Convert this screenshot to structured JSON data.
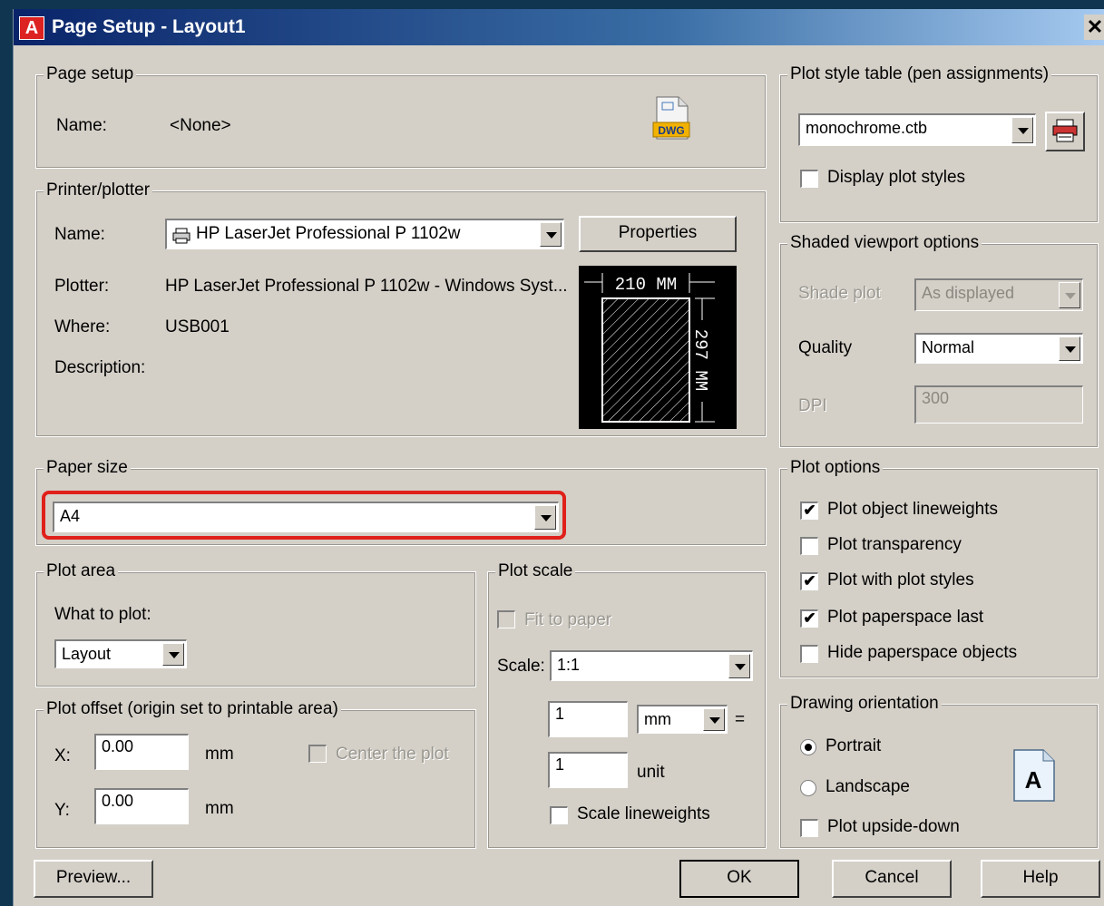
{
  "window": {
    "title": "Page Setup - Layout1",
    "close_glyph": "✕",
    "app_icon_letter": "A"
  },
  "page_setup": {
    "group_label": "Page setup",
    "name_label": "Name:",
    "name_value": "<None>",
    "dwg_icon_label": "DWG"
  },
  "printer": {
    "group_label": "Printer/plotter",
    "name_label": "Name:",
    "name_value": "HP LaserJet Professional P 1102w",
    "properties_label": "Properties",
    "plotter_label": "Plotter:",
    "plotter_value": "HP LaserJet Professional P 1102w - Windows Syst...",
    "where_label": "Where:",
    "where_value": "USB001",
    "description_label": "Description:",
    "preview_width_label": "210 MM",
    "preview_height_label": "297 MM"
  },
  "paper_size": {
    "group_label": "Paper size",
    "value": "A4",
    "highlight_color": "#e0201a"
  },
  "plot_area": {
    "group_label": "Plot area",
    "what_label": "What to plot:",
    "what_value": "Layout"
  },
  "plot_offset": {
    "group_label": "Plot offset (origin set to printable area)",
    "x_label": "X:",
    "x_value": "0.00",
    "x_unit": "mm",
    "y_label": "Y:",
    "y_value": "0.00",
    "y_unit": "mm",
    "center_label": "Center the plot"
  },
  "plot_scale": {
    "group_label": "Plot scale",
    "fit_label": "Fit to paper",
    "scale_label": "Scale:",
    "scale_value": "1:1",
    "num1_value": "1",
    "unit_select_value": "mm",
    "equals": "=",
    "num2_value": "1",
    "unit2_label": "unit",
    "lineweights_label": "Scale lineweights"
  },
  "plot_style": {
    "group_label": "Plot style table (pen assignments)",
    "value": "monochrome.ctb",
    "display_label": "Display plot styles"
  },
  "shaded": {
    "group_label": "Shaded viewport options",
    "shade_label": "Shade plot",
    "shade_value": "As displayed",
    "quality_label": "Quality",
    "quality_value": "Normal",
    "dpi_label": "DPI",
    "dpi_value": "300"
  },
  "plot_options": {
    "group_label": "Plot options",
    "items": [
      {
        "label": "Plot object lineweights",
        "checked": true
      },
      {
        "label": "Plot transparency",
        "checked": false
      },
      {
        "label": "Plot with plot styles",
        "checked": true
      },
      {
        "label": "Plot paperspace last",
        "checked": true
      },
      {
        "label": "Hide paperspace objects",
        "checked": false
      }
    ]
  },
  "orientation": {
    "group_label": "Drawing orientation",
    "portrait_label": "Portrait",
    "landscape_label": "Landscape",
    "upside_label": "Plot upside-down",
    "icon_letter": "A"
  },
  "buttons": {
    "preview": "Preview...",
    "ok": "OK",
    "cancel": "Cancel",
    "help": "Help"
  },
  "check_glyph": "✔"
}
